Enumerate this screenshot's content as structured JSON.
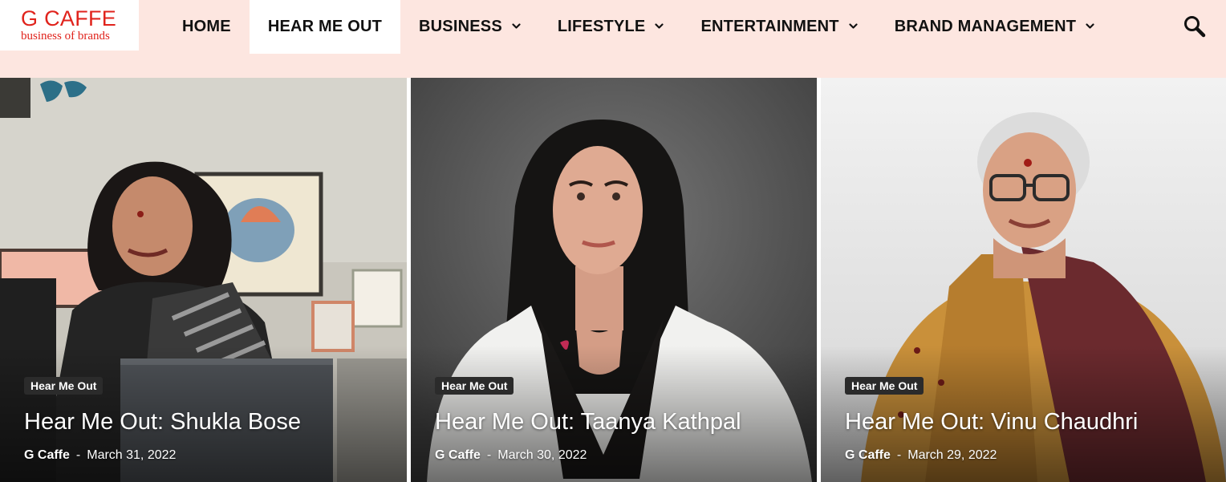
{
  "site": {
    "logo_title": "G CAFFE",
    "logo_subtitle": "business of brands"
  },
  "nav": {
    "items": [
      {
        "label": "HOME",
        "active": false,
        "dropdown": false
      },
      {
        "label": "HEAR ME OUT",
        "active": true,
        "dropdown": false
      },
      {
        "label": "BUSINESS",
        "active": false,
        "dropdown": true
      },
      {
        "label": "LIFESTYLE",
        "active": false,
        "dropdown": true
      },
      {
        "label": "ENTERTAINMENT",
        "active": false,
        "dropdown": true
      },
      {
        "label": "BRAND MANAGEMENT",
        "active": false,
        "dropdown": true
      }
    ],
    "search_icon": "search-icon",
    "dropdown_icon": "chevron-down-icon"
  },
  "cards": [
    {
      "category": "Hear Me Out",
      "title": "Hear Me Out: Shukla Bose",
      "author": "G Caffe",
      "separator": "-",
      "date": "March 31, 2022"
    },
    {
      "category": "Hear Me Out",
      "title": "Hear Me Out: Taanya Kathpal",
      "author": "G Caffe",
      "separator": "-",
      "date": "March 30, 2022"
    },
    {
      "category": "Hear Me Out",
      "title": "Hear Me Out: Vinu Chaudhri",
      "author": "G Caffe",
      "separator": "-",
      "date": "March 29, 2022"
    }
  ],
  "colors": {
    "header_bg": "#fde6e0",
    "brand_red": "#e0231c",
    "badge_bg": "#2b2b2b"
  }
}
